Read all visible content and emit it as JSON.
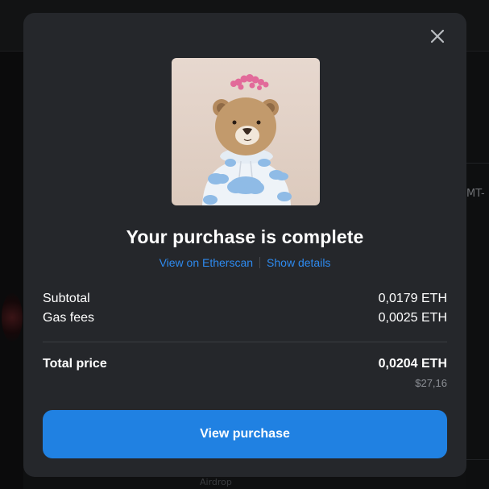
{
  "background": {
    "right_edge_text": "MT-",
    "bottom_text": "Airdrop"
  },
  "modal": {
    "close_icon": "close-icon",
    "nft_image": "teddy-bear-nft-image",
    "title": "Your purchase is complete",
    "links": {
      "etherscan": "View on Etherscan",
      "details": "Show details"
    },
    "summary": {
      "subtotal_label": "Subtotal",
      "subtotal_value": "0,0179 ETH",
      "gas_label": "Gas fees",
      "gas_value": "0,0025 ETH",
      "total_label": "Total price",
      "total_value": "0,0204 ETH",
      "total_usd": "$27,16"
    },
    "primary_button": "View purchase"
  },
  "colors": {
    "modal_bg": "#25272b",
    "accent": "#2081e2",
    "link": "#2e8bf0",
    "muted_text": "#8d9096"
  }
}
